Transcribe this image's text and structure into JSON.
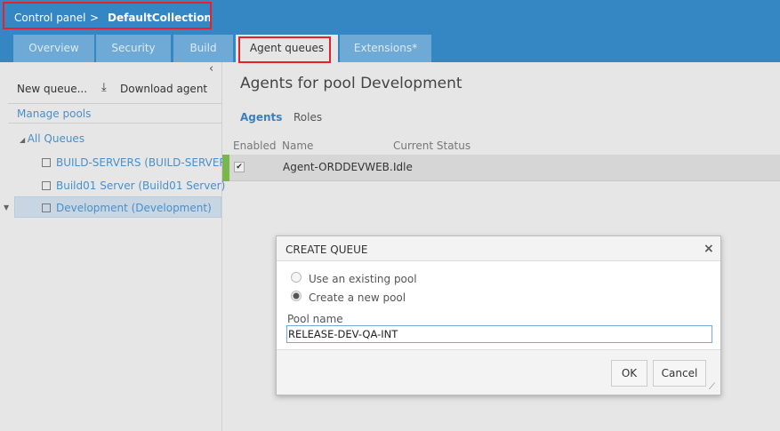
{
  "header": {
    "breadcrumb_root": "Control panel",
    "breadcrumb_sep": ">",
    "breadcrumb_current": "DefaultCollection"
  },
  "tabs": [
    {
      "label": "Overview"
    },
    {
      "label": "Security"
    },
    {
      "label": "Build"
    },
    {
      "label": "Agent queues",
      "active": true
    },
    {
      "label": "Extensions*"
    }
  ],
  "sidebar": {
    "collapse": "‹",
    "new_queue": "New queue...",
    "download_agent": "Download agent",
    "manage_pools": "Manage pools",
    "root": "All Queues",
    "items": [
      {
        "label": "BUILD-SERVERS (BUILD-SERVERS)"
      },
      {
        "label": "Build01 Server (Build01 Server)"
      },
      {
        "label": "Development (Development)",
        "selected": true
      }
    ]
  },
  "main": {
    "title": "Agents for pool Development",
    "subtabs": [
      "Agents",
      "Roles"
    ],
    "columns": [
      "Enabled",
      "Name",
      "Current Status"
    ],
    "rows": [
      {
        "enabled": true,
        "name": "Agent-ORDDEVWEB...",
        "status": "Idle"
      }
    ]
  },
  "dialog": {
    "title": "CREATE QUEUE",
    "close": "×",
    "option_existing": "Use an existing pool",
    "option_new": "Create a new pool",
    "selected_option": "new",
    "pool_name_label": "Pool name",
    "pool_name_value": "RELEASE-DEV-QA-INT",
    "ok": "OK",
    "cancel": "Cancel"
  },
  "colors": {
    "header": "#3587c4",
    "tab": "#6eaad5",
    "highlight": "#e8202a",
    "link": "#4a8fc8",
    "enabled_bar": "#7ab648"
  }
}
